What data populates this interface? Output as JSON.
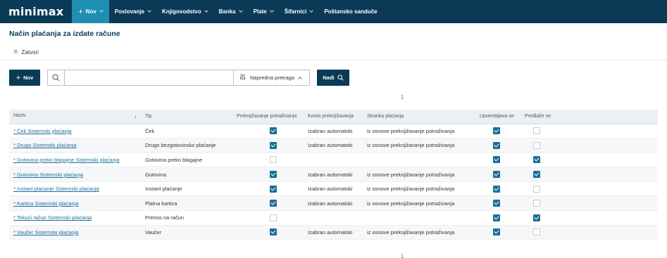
{
  "app": {
    "logo": "minimax",
    "new_label": "Nov",
    "menu": [
      "Poslovanje",
      "Knjigovodstvo",
      "Banka",
      "Plate",
      "Šifarnici"
    ],
    "mailbox": "Poštansko sanduče"
  },
  "page": {
    "title": "Način plaćanja za izdate račune",
    "close_label": "Zatvori"
  },
  "toolbar": {
    "new_label": "Nov",
    "search_value": "",
    "advanced_label": "Napredna pretraga",
    "find_label": "Nađi"
  },
  "pagination": {
    "top": "1",
    "bottom": "1"
  },
  "table": {
    "headers": [
      "Naziv",
      "Tip",
      "Preknjižavanje potraživanja",
      "Konto preknjižavanja",
      "Stranka plaćanja",
      "Upotrebljava se",
      "Predlaže se"
    ],
    "rows": [
      {
        "name": "* Ček Sistemski plaćanja",
        "type": "Ček",
        "repost": true,
        "account": "Izabran automatski",
        "party": "iz osnove preknjižavanje potraživanja",
        "used": true,
        "suggested": false
      },
      {
        "name": "* Drugo Sistemski plaćanja",
        "type": "Drugo bezgotovinsko plaćanje",
        "repost": true,
        "account": "Izabran automatski",
        "party": "iz osnove preknjižavanje potraživanja",
        "used": true,
        "suggested": false
      },
      {
        "name": "* Gotovina preko blagajne Sistemski plaćanja",
        "type": "Gotovina preko blagajne",
        "repost": false,
        "account": "",
        "party": "",
        "used": true,
        "suggested": true
      },
      {
        "name": "* Gotovina Sistemski plaćanja",
        "type": "Gotovina",
        "repost": true,
        "account": "Izabran automatski",
        "party": "iz osnove preknjižavanje potraživanja",
        "used": true,
        "suggested": true
      },
      {
        "name": "* Instant plaćanje Sistemski plaćanja",
        "type": "Instant plaćanje",
        "repost": true,
        "account": "Izabran automatski",
        "party": "iz osnove preknjižavanje potraživanja",
        "used": true,
        "suggested": false
      },
      {
        "name": "* Kartica Sistemski plaćanja",
        "type": "Platna kartica",
        "repost": true,
        "account": "Izabran automatski",
        "party": "iz osnove preknjižavanje potraživanja",
        "used": true,
        "suggested": false
      },
      {
        "name": "* Tekući račun Sistemski plaćanja",
        "type": "Prenos na račun",
        "repost": false,
        "account": "",
        "party": "",
        "used": true,
        "suggested": true
      },
      {
        "name": "* Vaučer Sistemski plaćanja",
        "type": "Vaučer",
        "repost": true,
        "account": "Izabran automatski",
        "party": "iz osnove preknjižavanje potraživanja",
        "used": true,
        "suggested": false
      }
    ]
  },
  "colors": {
    "nav": "#0b3a57",
    "accent": "#1e8fb3",
    "link": "#1e6fa0",
    "checkbox": "#1b6f97"
  }
}
